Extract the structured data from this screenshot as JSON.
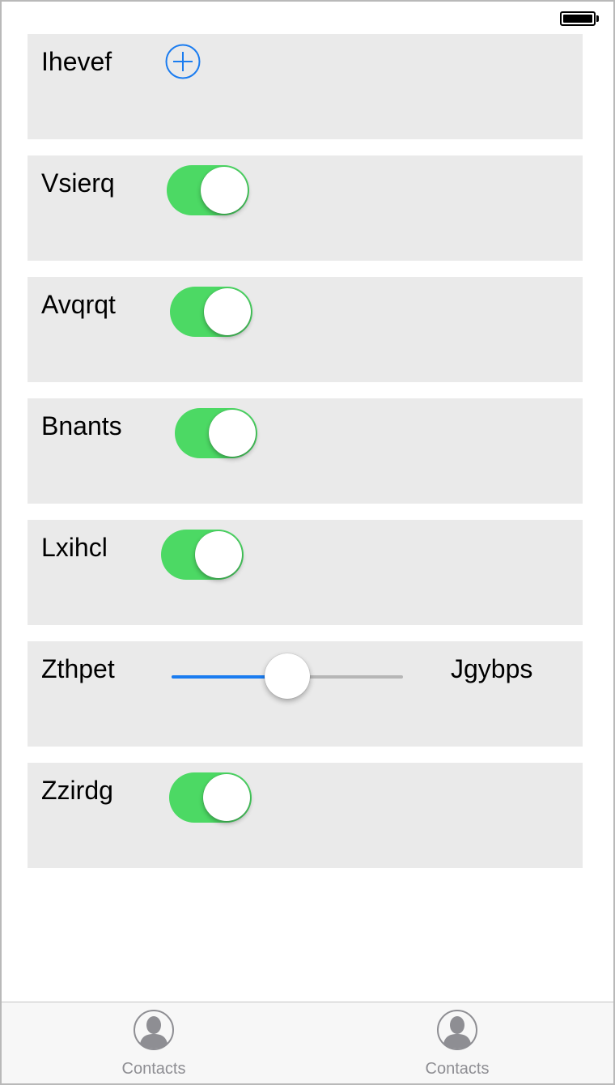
{
  "status_bar": {
    "battery_icon": "battery-full-icon"
  },
  "rows": [
    {
      "label": "Ihevef",
      "control": "add-button",
      "icon": "plus-circle-icon",
      "accent": "#1a7cf0"
    },
    {
      "label": "Vsierq",
      "control": "toggle",
      "on": true
    },
    {
      "label": "Avqrqt",
      "control": "toggle",
      "on": true
    },
    {
      "label": "Bnants",
      "control": "toggle",
      "on": true
    },
    {
      "label": "Lxihcl",
      "control": "toggle",
      "on": true
    },
    {
      "label": "Zthpet",
      "control": "slider",
      "value": 0.5,
      "right_label": "Jgybps"
    },
    {
      "label": "Zzirdg",
      "control": "toggle",
      "on": true
    }
  ],
  "colors": {
    "toggle_on": "#4cd964",
    "slider_fill": "#1a7cf0",
    "slider_track": "#b6b6b6",
    "row_background": "#eaeaea",
    "tab_label": "#8e8e93"
  },
  "tab_bar": {
    "items": [
      {
        "label": "Contacts",
        "icon": "contacts-icon"
      },
      {
        "label": "Contacts",
        "icon": "contacts-icon"
      }
    ]
  }
}
